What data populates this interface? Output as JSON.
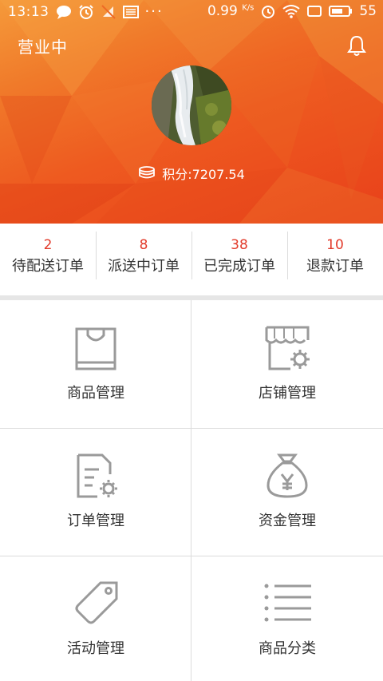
{
  "status_bar": {
    "time": "13:13",
    "net_speed": "0.99",
    "net_unit": "K/s",
    "battery": "55"
  },
  "header": {
    "status": "营业中",
    "points": "积分:7207.54"
  },
  "orders": [
    {
      "count": "2",
      "label": "待配送订单"
    },
    {
      "count": "8",
      "label": "派送中订单"
    },
    {
      "count": "38",
      "label": "已完成订单"
    },
    {
      "count": "10",
      "label": "退款订单"
    }
  ],
  "menu": [
    {
      "label": "商品管理",
      "icon": "shopping-bag-icon"
    },
    {
      "label": "店铺管理",
      "icon": "store-settings-icon"
    },
    {
      "label": "订单管理",
      "icon": "order-document-icon"
    },
    {
      "label": "资金管理",
      "icon": "money-bag-icon"
    },
    {
      "label": "活动管理",
      "icon": "tag-icon"
    },
    {
      "label": "商品分类",
      "icon": "list-icon"
    }
  ],
  "colors": {
    "accent": "#ee5a20",
    "count_red": "#e23a2a",
    "icon_gray": "#9a9a9a"
  }
}
